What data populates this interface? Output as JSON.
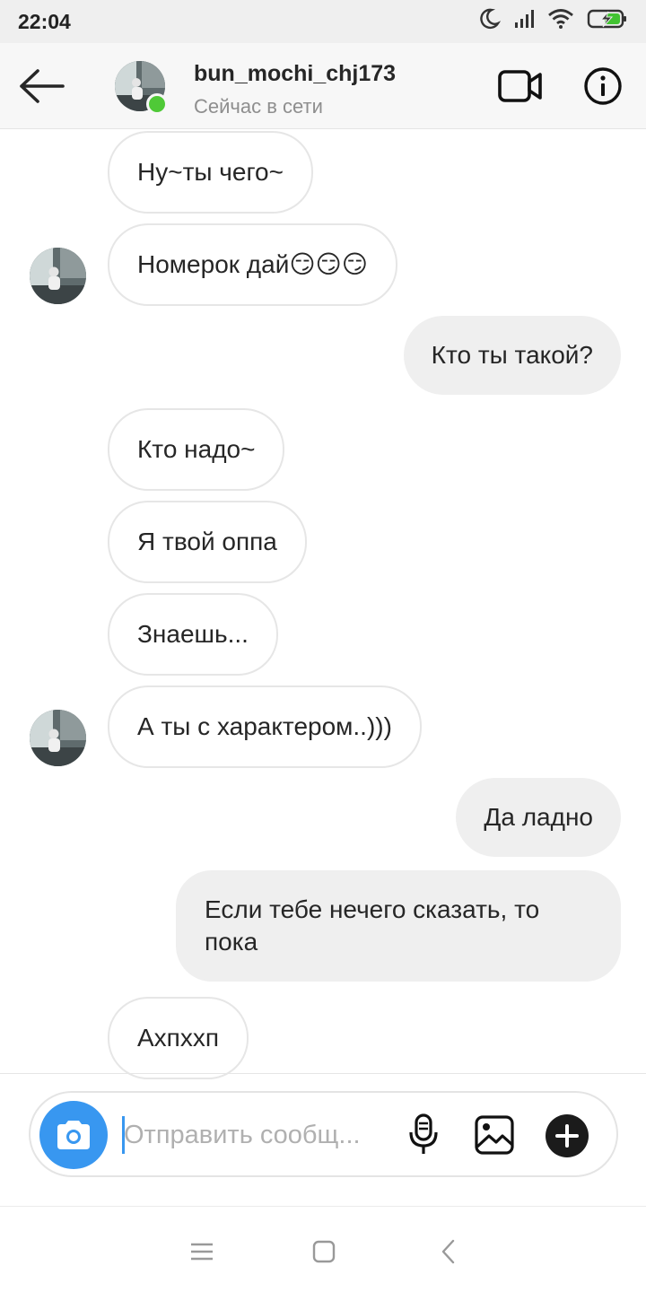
{
  "status_bar": {
    "time": "22:04",
    "icons": [
      "moon-icon",
      "signal-icon",
      "wifi-icon",
      "battery-charging-icon"
    ]
  },
  "header": {
    "username": "bun_mochi_chj173",
    "status": "Сейчас в сети",
    "online": true,
    "icons": [
      "back-arrow-icon",
      "video-call-icon",
      "info-icon"
    ]
  },
  "messages": [
    {
      "side": "in",
      "text": "Ну~ты чего~"
    },
    {
      "side": "in",
      "text": "Номерок дай😏😏😏",
      "avatar": true
    },
    {
      "side": "out",
      "text": "Кто ты такой?"
    },
    {
      "side": "in",
      "text": "Кто надо~"
    },
    {
      "side": "in",
      "text": "Я твой оппа"
    },
    {
      "side": "in",
      "text": "Знаешь..."
    },
    {
      "side": "in",
      "text": "А ты с характером..)))",
      "avatar": true
    },
    {
      "side": "out",
      "text": "Да ладно"
    },
    {
      "side": "out",
      "text": "Если тебе нечего сказать, то пока"
    },
    {
      "side": "in",
      "text": "Ахпххп"
    }
  ],
  "composer": {
    "placeholder": "Отправить сообщ...",
    "value": "",
    "icons": [
      "camera-icon",
      "microphone-icon",
      "gallery-icon",
      "plus-icon"
    ]
  },
  "nav_bar": {
    "icons": [
      "menu-icon",
      "home-square-icon",
      "back-chevron-icon"
    ]
  },
  "colors": {
    "accent": "#3897f0",
    "online": "#4fc937",
    "outgoing_bubble": "#efefef",
    "incoming_border": "#e6e6e6"
  }
}
